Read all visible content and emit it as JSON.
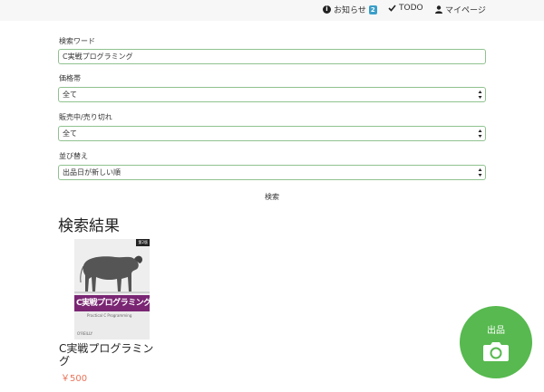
{
  "header": {
    "notifications_label": "お知らせ",
    "notifications_count": "2",
    "todo_label": "TODO",
    "mypage_label": "マイページ"
  },
  "search_form": {
    "keyword_label": "検索ワード",
    "keyword_value": "C実戦プログラミング",
    "price_label": "価格帯",
    "price_value": "全て",
    "status_label": "販売中/売り切れ",
    "status_value": "全て",
    "sort_label": "並び替え",
    "sort_value": "出品日が新しい順",
    "search_button": "検索"
  },
  "results": {
    "title": "検索結果",
    "items": [
      {
        "title": "C実戦プログラミング",
        "price": "￥500",
        "cover": {
          "title": "C実戦プログラミング",
          "edition": "第2版",
          "subtitle": "Practical C Programming",
          "publisher": "O'REILLY"
        }
      }
    ]
  },
  "sell_button": {
    "label": "出品"
  },
  "colors": {
    "accent_green": "#57b94f",
    "field_border": "#8fc28f",
    "price": "#e8745a",
    "badge": "#3a9fc8",
    "cover_band": "#7a2673"
  }
}
